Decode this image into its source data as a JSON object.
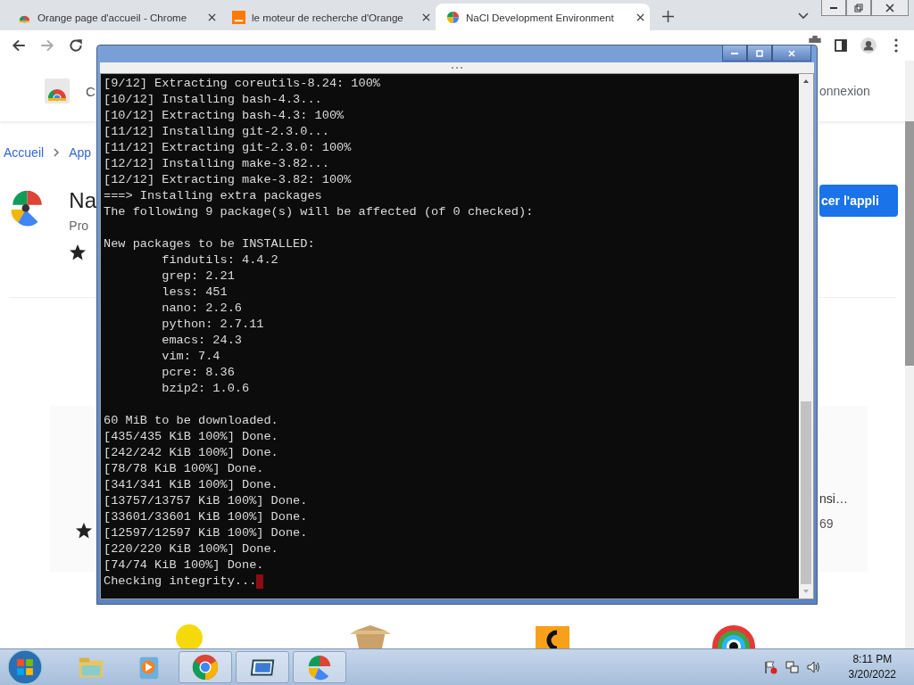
{
  "browser": {
    "tabs": [
      {
        "title": "Orange page d'accueil - Chrome",
        "selected": false,
        "kind": "store"
      },
      {
        "title": "le moteur de recherche d'Orange",
        "selected": false,
        "kind": "search"
      },
      {
        "title": "NaCl Development Environment",
        "selected": true,
        "kind": "pie"
      }
    ]
  },
  "page": {
    "header": {
      "brand": "C",
      "signin": "onnexion"
    },
    "breadcrumb": [
      "Accueil",
      "App"
    ],
    "app": {
      "name": "Na",
      "subtitle": "Pro",
      "action": "cer l'appli"
    },
    "card": {
      "title": "nsi…",
      "count": "69"
    }
  },
  "terminal": {
    "blocks": [
      [
        "[9/12] Extracting coreutils-8.24: 100%",
        "[10/12] Installing bash-4.3...",
        "[10/12] Extracting bash-4.3: 100%",
        "[11/12] Installing git-2.3.0...",
        "[11/12] Extracting git-2.3.0: 100%",
        "[12/12] Installing make-3.82...",
        "[12/12] Extracting make-3.82: 100%",
        "===> Installing extra packages",
        "The following 9 package(s) will be affected (of 0 checked):"
      ],
      [
        "New packages to be INSTALLED:",
        "        findutils: 4.4.2",
        "        grep: 2.21",
        "        less: 451",
        "        nano: 2.2.6",
        "        python: 2.7.11",
        "        emacs: 24.3",
        "        vim: 7.4",
        "        pcre: 8.36",
        "        bzip2: 1.0.6"
      ],
      [
        "60 MiB to be downloaded.",
        "[435/435 KiB 100%] Done.",
        "[242/242 KiB 100%] Done.",
        "[78/78 KiB 100%] Done.",
        "[341/341 KiB 100%] Done.",
        "[13757/13757 KiB 100%] Done.",
        "[33601/33601 KiB 100%] Done.",
        "[12597/12597 KiB 100%] Done.",
        "[220/220 KiB 100%] Done.",
        "[74/74 KiB 100%] Done.",
        "Checking integrity..."
      ]
    ],
    "cursor": true
  },
  "taskbar": {
    "items": [
      {
        "kind": "explorer",
        "running": false
      },
      {
        "kind": "media",
        "running": false
      },
      {
        "kind": "chrome",
        "running": true
      },
      {
        "kind": "window",
        "running": true
      },
      {
        "kind": "nacl",
        "running": true
      }
    ],
    "time": "8:11 PM",
    "date": "3/20/2022"
  }
}
